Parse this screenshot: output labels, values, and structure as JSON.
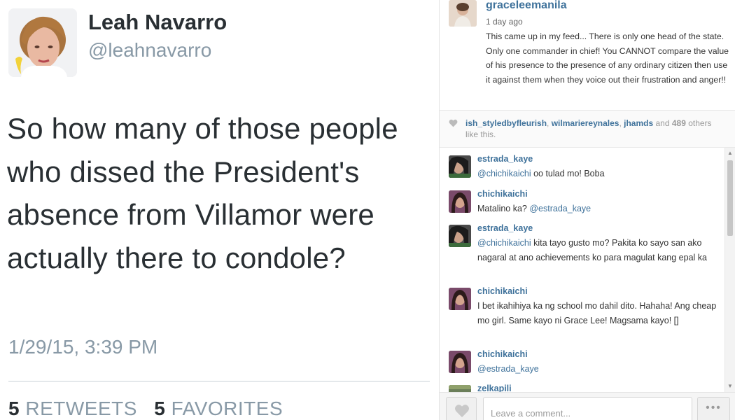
{
  "tweet": {
    "author_name": "Leah Navarro",
    "handle": "@leahnavarro",
    "text": "So how many of those people who dissed the President's absence from Villamor were actually there to condole?",
    "timestamp": "1/29/15, 3:39 PM",
    "retweets_count": "5",
    "retweets_label": "RETWEETS",
    "favorites_count": "5",
    "favorites_label": "FAVORITES"
  },
  "post": {
    "username": "graceleemanila",
    "time_ago": "1 day ago",
    "caption": "This came up in my feed... There is only one head of the state. Only one commander in chief! You CANNOT compare the value of his presence to the presence of any ordinary citizen then use it against them when they voice out their frustration and anger!!"
  },
  "likes": {
    "user1": "ish_styledbyfleurish",
    "sep1": ", ",
    "user2": "wilmariereynales",
    "sep2": ", ",
    "user3": "jhamds",
    "and_text": " and ",
    "count": "489",
    "suffix": " others like this."
  },
  "comments": [
    {
      "user": "estrada_kaye",
      "mention": "@chichikaichi",
      "text": " oo tulad mo! Boba",
      "mention_after": ""
    },
    {
      "user": "chichikaichi",
      "mention": "",
      "text": "Matalino ka? ",
      "mention_after": "@estrada_kaye"
    },
    {
      "user": "estrada_kaye",
      "mention": "@chichikaichi",
      "text": " kita tayo gusto mo? Pakita ko sayo san ako nagaral at ano achievements ko para magulat kang epal ka",
      "mention_after": ""
    },
    {
      "user": "chichikaichi",
      "mention": "",
      "text": "I bet ikahihiya ka ng school mo dahil dito. Hahaha! Ang cheap mo girl. Same kayo ni Grace Lee! Magsama kayo! []",
      "mention_after": ""
    },
    {
      "user": "chichikaichi",
      "mention": "@estrada_kaye",
      "text": "",
      "mention_after": ""
    },
    {
      "user": "zelkapili",
      "mention": "",
      "text": "",
      "mention_after": ""
    }
  ],
  "comment_bar": {
    "placeholder": "Leave a comment...",
    "more_label": "•••"
  },
  "icons": {
    "heart": "heart-icon",
    "more": "more-options-icon"
  },
  "colors": {
    "instagram_link": "#3f729b",
    "twitter_text": "#292f33",
    "twitter_muted": "#8899a6"
  }
}
